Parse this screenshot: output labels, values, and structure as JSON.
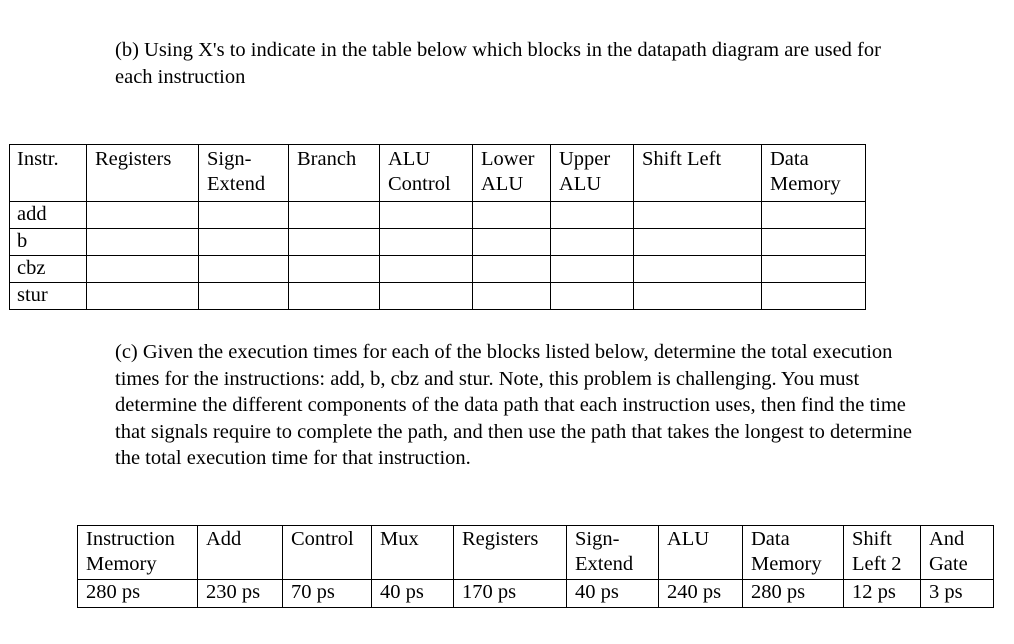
{
  "part_b": {
    "text": "(b) Using X's to indicate in the table below which blocks in the datapath diagram are used for each instruction"
  },
  "blocks_table": {
    "headers": [
      "Instr.",
      "Registers",
      "Sign-\nExtend",
      "Branch",
      "ALU\nControl",
      "Lower\nALU",
      "Upper\nALU",
      "Shift Left",
      "Data\nMemory"
    ],
    "rows": [
      {
        "instr": "add",
        "cells": [
          "",
          "",
          "",
          "",
          "",
          "",
          "",
          ""
        ]
      },
      {
        "instr": "b",
        "cells": [
          "",
          "",
          "",
          "",
          "",
          "",
          "",
          ""
        ]
      },
      {
        "instr": "cbz",
        "cells": [
          "",
          "",
          "",
          "",
          "",
          "",
          "",
          ""
        ]
      },
      {
        "instr": "stur",
        "cells": [
          "",
          "",
          "",
          "",
          "",
          "",
          "",
          ""
        ]
      }
    ]
  },
  "part_c": {
    "text": "(c) Given the execution times for each of the blocks listed below, determine the total execution times for the instructions: add, b, cbz and stur. Note, this problem is challenging. You must determine the different components of the data path that each instruction uses, then find the time that signals require to complete the path, and then use the path that takes the longest to determine the total execution time for that instruction."
  },
  "times_table": {
    "headers": [
      "Instruction\nMemory",
      "Add",
      "Control",
      "Mux",
      "Registers",
      "Sign-\nExtend",
      "ALU",
      "Data\nMemory",
      "Shift\nLeft 2",
      "And\nGate"
    ],
    "values": [
      "280 ps",
      "230 ps",
      "70 ps",
      "40 ps",
      "170 ps",
      "40 ps",
      "240 ps",
      "280 ps",
      "12 ps",
      "3 ps"
    ]
  }
}
